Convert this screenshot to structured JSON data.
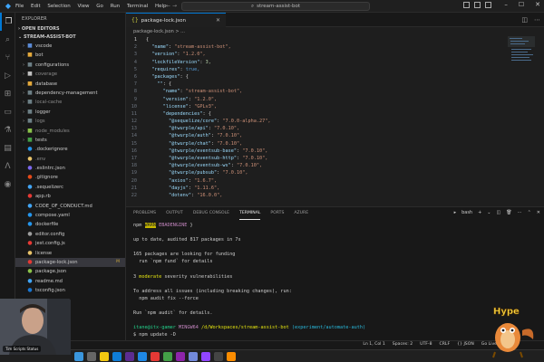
{
  "titlebar": {
    "menu": [
      "File",
      "Edit",
      "Selection",
      "View",
      "Go",
      "Run",
      "Terminal",
      "Help"
    ],
    "search": "stream-assist-bot"
  },
  "sidebar": {
    "header": "EXPLORER",
    "open_editors": "OPEN EDITORS",
    "project": "STREAM-ASSIST-BOT",
    "items": [
      {
        "name": "vscode",
        "type": "folder",
        "color": "#5b8bd6"
      },
      {
        "name": "bot",
        "type": "folder",
        "color": "#e4a93b"
      },
      {
        "name": "configurations",
        "type": "folder",
        "color": "#6d8086"
      },
      {
        "name": "coverage",
        "type": "folder",
        "color": "#c0c0c0",
        "dim": true
      },
      {
        "name": "database",
        "type": "folder",
        "color": "#e4a93b"
      },
      {
        "name": "dependency-management",
        "type": "folder",
        "color": "#6d8086"
      },
      {
        "name": "local-cache",
        "type": "folder",
        "color": "#6d8086",
        "dim": true
      },
      {
        "name": "logger",
        "type": "folder",
        "color": "#6d8086"
      },
      {
        "name": "logs",
        "type": "folder",
        "color": "#6d8086",
        "dim": true
      },
      {
        "name": "node_modules",
        "type": "folder",
        "color": "#8bc34a",
        "dim": true
      },
      {
        "name": "tests",
        "type": "folder",
        "color": "#43a047"
      },
      {
        "name": ".dockerignore",
        "type": "file",
        "color": "#2496ed"
      },
      {
        "name": ".env",
        "type": "file",
        "color": "#e9c46a",
        "dim": true
      },
      {
        "name": ".eslintrc.json",
        "type": "file",
        "color": "#7b68ee"
      },
      {
        "name": ".gitignore",
        "type": "file",
        "color": "#e64a19"
      },
      {
        "name": ".sequelizerc",
        "type": "file",
        "color": "#42a5f5"
      },
      {
        "name": "app.rb",
        "type": "file",
        "color": "#e53935"
      },
      {
        "name": "CODE_OF_CONDUCT.md",
        "type": "file",
        "color": "#42a5f5"
      },
      {
        "name": "compose.yaml",
        "type": "file",
        "color": "#2496ed"
      },
      {
        "name": "dockerfile",
        "type": "file",
        "color": "#2496ed"
      },
      {
        "name": "editor.config",
        "type": "file",
        "color": "#9e9e9e"
      },
      {
        "name": "jest.config.js",
        "type": "file",
        "color": "#e53935"
      },
      {
        "name": "license",
        "type": "file",
        "color": "#e9c46a"
      },
      {
        "name": "package-lock.json",
        "type": "file",
        "color": "#e53935",
        "selected": true,
        "badge": "M"
      },
      {
        "name": "package.json",
        "type": "file",
        "color": "#8bc34a"
      },
      {
        "name": "readme.md",
        "type": "file",
        "color": "#42a5f5"
      },
      {
        "name": "tsconfig.json",
        "type": "file",
        "color": "#1976d2"
      }
    ]
  },
  "editor": {
    "tab_label": "package-lock.json",
    "breadcrumb": "package-lock.json > ...",
    "lines": [
      {
        "n": "1",
        "t": "{"
      },
      {
        "n": "2",
        "t": "  \"name\": \"stream-assist-bot\","
      },
      {
        "n": "3",
        "t": "  \"version\": \"1.2.0\","
      },
      {
        "n": "4",
        "t": "  \"lockfileVersion\": 3,"
      },
      {
        "n": "5",
        "t": "  \"requires\": true,"
      },
      {
        "n": "6",
        "t": "  \"packages\": {"
      },
      {
        "n": "7",
        "t": "    \"\": {"
      },
      {
        "n": "8",
        "t": "      \"name\": \"stream-assist-bot\","
      },
      {
        "n": "9",
        "t": "      \"version\": \"1.2.0\","
      },
      {
        "n": "10",
        "t": "      \"license\": \"GPLv3\","
      },
      {
        "n": "11",
        "t": "      \"dependencies\": {"
      },
      {
        "n": "12",
        "t": "        \"@sequelize/core\": \"7.0.0-alpha.27\","
      },
      {
        "n": "13",
        "t": "        \"@twurple/api\": \"7.0.10\","
      },
      {
        "n": "14",
        "t": "        \"@twurple/auth\": \"7.0.10\","
      },
      {
        "n": "15",
        "t": "        \"@twurple/chat\": \"7.0.10\","
      },
      {
        "n": "16",
        "t": "        \"@twurple/eventsub-base\": \"7.0.10\","
      },
      {
        "n": "17",
        "t": "        \"@twurple/eventsub-http\": \"7.0.10\","
      },
      {
        "n": "18",
        "t": "        \"@twurple/eventsub-ws\": \"7.0.10\","
      },
      {
        "n": "19",
        "t": "        \"@twurple/pubsub\": \"7.0.10\","
      },
      {
        "n": "20",
        "t": "        \"axios\": \"1.6.7\","
      },
      {
        "n": "21",
        "t": "        \"dayjs\": \"1.11.6\","
      },
      {
        "n": "22",
        "t": "        \"dotenv\": \"16.0.0\","
      }
    ]
  },
  "panel": {
    "tabs": [
      "PROBLEMS",
      "OUTPUT",
      "DEBUG CONSOLE",
      "TERMINAL",
      "PORTS",
      "AZURE"
    ],
    "active_tab": "TERMINAL",
    "shell": "bash",
    "lines": {
      "l1_a": "npm ",
      "l1_b": "WARN",
      "l1_c": " EBADENGINE ",
      "l1_d": "}",
      "l2": "up to date, audited 817 packages in 7s",
      "l3": "165 packages are looking for funding",
      "l4": "  run `npm fund` for details",
      "l5_a": "3 ",
      "l5_b": "moderate",
      "l5_c": " severity vulnerabilities",
      "l6": "To address all issues (including breaking changes), run:",
      "l7": "  npm audit fix --force",
      "l8": "Run `npm audit` for details.",
      "l9_user": "itane@itx-gamer",
      "l9_host": " MINGW64 ",
      "l9_path": "/d/Workspaces/stream-assist-bot",
      "l9_branch": " (experiment/automate-auth)",
      "l10": "$ npm update -D"
    }
  },
  "statusbar": {
    "items": [
      "Ln 1, Col 1",
      "Spaces: 2",
      "UTF-8",
      "CRLF",
      "{} JSON",
      "Go Live"
    ]
  },
  "webcam": {
    "label": "Tim Scripts Status"
  },
  "mascot": {
    "label": "Hype"
  }
}
